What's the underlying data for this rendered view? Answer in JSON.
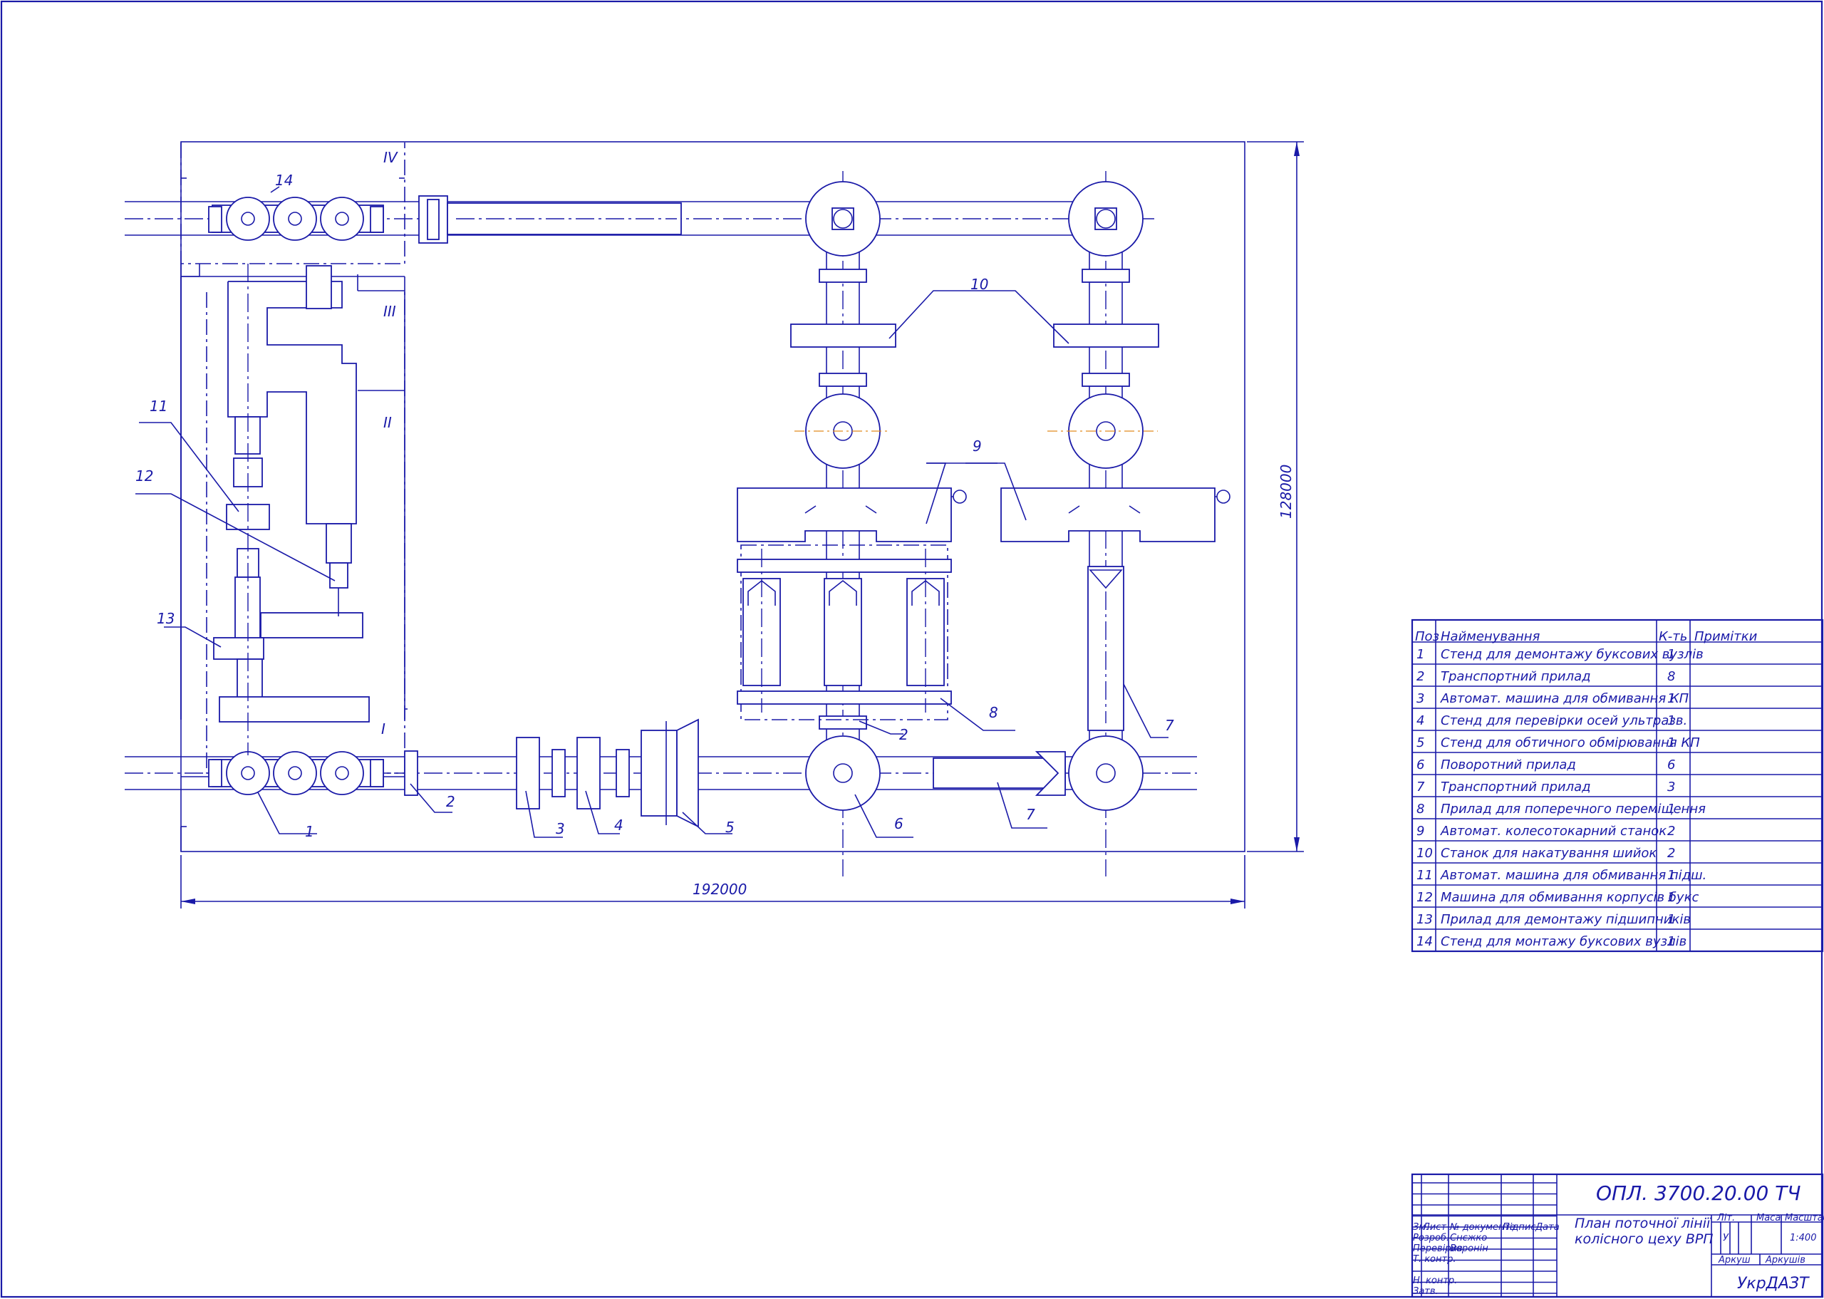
{
  "roman": [
    "IV",
    "III",
    "II",
    "I"
  ],
  "dims": {
    "width": "192000",
    "height": "128000"
  },
  "callouts": [
    "1",
    "2",
    "3",
    "4",
    "5",
    "6",
    "7",
    "7",
    "8",
    "9",
    "10",
    "11",
    "12",
    "13",
    "14",
    "2"
  ],
  "spec": {
    "headers": {
      "pos": "Поз",
      "name": "Найменування",
      "qty": "К-ть",
      "note": "Примітки"
    },
    "rows": [
      {
        "pos": "1",
        "name": "Стенд для демонтажу буксових вузлів",
        "qty": "1"
      },
      {
        "pos": "2",
        "name": "Транспортний прилад",
        "qty": "8"
      },
      {
        "pos": "3",
        "name": "Автомат. машина для обмивання КП",
        "qty": "1"
      },
      {
        "pos": "4",
        "name": "Стенд для перевірки осей ультразв.",
        "qty": "1"
      },
      {
        "pos": "5",
        "name": "Стенд для обтичного обмірювання КП",
        "qty": "1"
      },
      {
        "pos": "6",
        "name": "Поворотний прилад",
        "qty": "6"
      },
      {
        "pos": "7",
        "name": "Транспортний прилад",
        "qty": "3"
      },
      {
        "pos": "8",
        "name": "Прилад для поперечного переміщення",
        "qty": "1"
      },
      {
        "pos": "9",
        "name": "Автомат. колесотокарний станок",
        "qty": "2"
      },
      {
        "pos": "10",
        "name": "Станок для накатування шийок",
        "qty": "2"
      },
      {
        "pos": "11",
        "name": "Автомат. машина для обмивання підш.",
        "qty": "1"
      },
      {
        "pos": "12",
        "name": "Машина для обмивання корпусів букс",
        "qty": "1"
      },
      {
        "pos": "13",
        "name": "Прилад для демонтажу підшипників",
        "qty": "1"
      },
      {
        "pos": "14",
        "name": "Стенд для монтажу буксових вузлів",
        "qty": "1"
      }
    ]
  },
  "titleblock": {
    "doc_code": "ОПЛ. 3700.20.00 ТЧ",
    "title_line1": "План поточної лінії",
    "title_line2": "колісного цеху ВРП",
    "col_izm": "Зм.",
    "col_list": "Лист",
    "col_doc": "№ документа",
    "col_sign": "Підпис",
    "col_date": "Дата",
    "row_razrab": "Розроб.",
    "razrab_name": "Снєжко",
    "row_perev": "Перевірив",
    "perev_name": "Воронін",
    "row_tkontr": "Т. контр.",
    "row_nkontr": "Н. контр.",
    "row_zatv": "Затв.",
    "lit": "Літ.",
    "masa": "Маса",
    "masshtab": "Масштаб",
    "lit_val": "У",
    "scale_val": "1:400",
    "arkush": "Аркуш",
    "arkushiv": "Аркушів",
    "org": "УкрДАЗТ"
  }
}
